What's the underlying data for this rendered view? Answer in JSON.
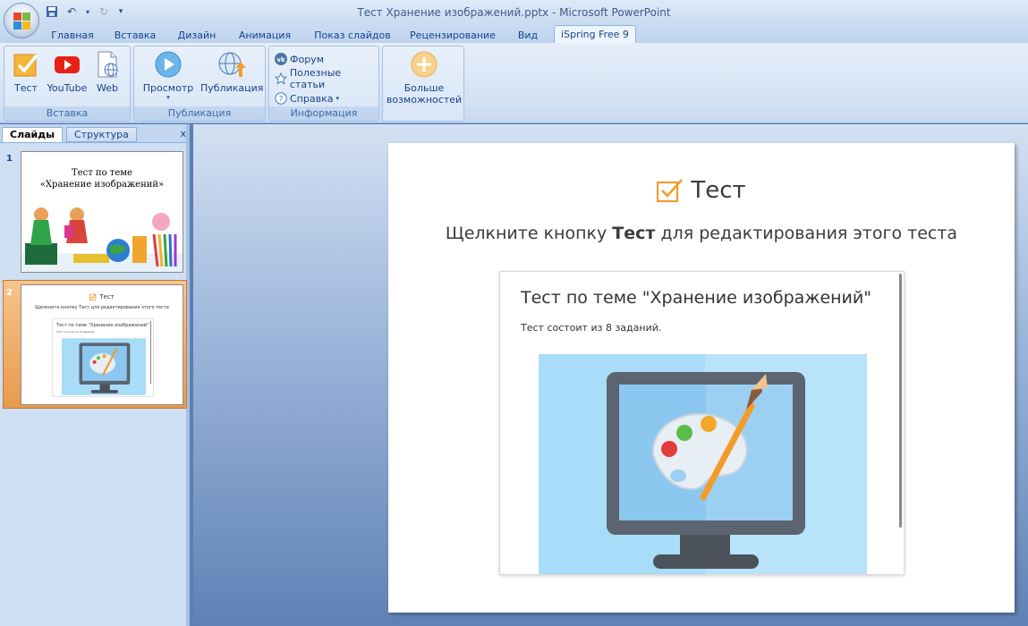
{
  "window": {
    "title": "Тест Хранение изображений.pptx - Microsoft PowerPoint"
  },
  "tabs": [
    {
      "label": "Главная"
    },
    {
      "label": "Вставка"
    },
    {
      "label": "Дизайн"
    },
    {
      "label": "Анимация"
    },
    {
      "label": "Показ слайдов"
    },
    {
      "label": "Рецензирование"
    },
    {
      "label": "Вид"
    },
    {
      "label": "iSpring Free 9"
    }
  ],
  "ribbon": {
    "insert_group": {
      "label": "Вставка",
      "buttons": [
        "Тест",
        "YouTube",
        "Web"
      ]
    },
    "publish_group": {
      "label": "Публикация",
      "buttons": [
        "Просмотр",
        "Публикация"
      ]
    },
    "info_group": {
      "label": "Информация",
      "items": [
        "Форум",
        "Полезные статьи",
        "Справка"
      ]
    },
    "more_group": {
      "label_line1": "Больше",
      "label_line2": "возможностей"
    }
  },
  "pane": {
    "tab_slides": "Слайды",
    "tab_outline": "Структура",
    "close": "x",
    "slide1": {
      "number": "1",
      "title_line1": "Тест по теме",
      "title_line2": "«Хранение изображений»"
    },
    "slide2": {
      "number": "2",
      "heading": "Тест",
      "sub": "Щелкните кнопку Тест для редактирования этого теста",
      "preview_title": "Тест по теме \"Хранение изображений\"",
      "preview_desc": "Тест состоит из 8 заданий."
    }
  },
  "slide": {
    "heading": "Тест",
    "sub_before": "Щелкните кнопку ",
    "sub_bold": "Тест",
    "sub_after": " для редактирования  этого теста",
    "preview_title": "Тест по теме \"Хранение изображений\"",
    "preview_desc": "Тест состоит из 8 заданий."
  },
  "colors": {
    "accent_orange": "#f39c2b",
    "ribbon_text": "#15428b",
    "preview_bg": "#a9dcf8"
  }
}
